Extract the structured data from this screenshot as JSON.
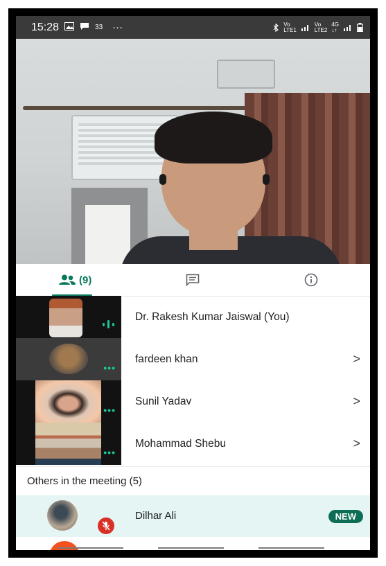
{
  "status_bar": {
    "time": "15:28",
    "icons": [
      "image-icon",
      "message-icon"
    ],
    "notif_count": "33",
    "more": "···",
    "right_icons": [
      "bluetooth-icon",
      "volte-lte1-icon",
      "signal-icon",
      "volte-lte2-icon",
      "4g-icon",
      "signal-icon",
      "battery-icon"
    ]
  },
  "tabs": [
    {
      "icon": "people-icon",
      "label": "(9)",
      "active": true
    },
    {
      "icon": "chat-icon",
      "label": ""
    },
    {
      "icon": "info-icon",
      "label": ""
    }
  ],
  "participants": [
    {
      "name": "Dr. Rakesh Kumar Jaiswal (You)",
      "status_icon": "speaking-bars-icon",
      "chevron": ""
    },
    {
      "name": "fardeen khan",
      "status_icon": "dots-icon",
      "chevron": ">"
    },
    {
      "name": "Sunil Yadav",
      "status_icon": "dots-icon",
      "chevron": ">"
    },
    {
      "name": "Mohammad Shebu",
      "status_icon": "dots-icon",
      "chevron": ">"
    }
  ],
  "others_header": "Others in the meeting (5)",
  "others": [
    {
      "name": "Dilhar Ali",
      "badge": "NEW",
      "muted": true
    }
  ],
  "colors": {
    "accent": "#0b7a5c",
    "status_bar": "#3a3a3a",
    "highlight_row": "#e5f5f3",
    "mute_red": "#d93025",
    "new_badge": "#0d6e55"
  }
}
